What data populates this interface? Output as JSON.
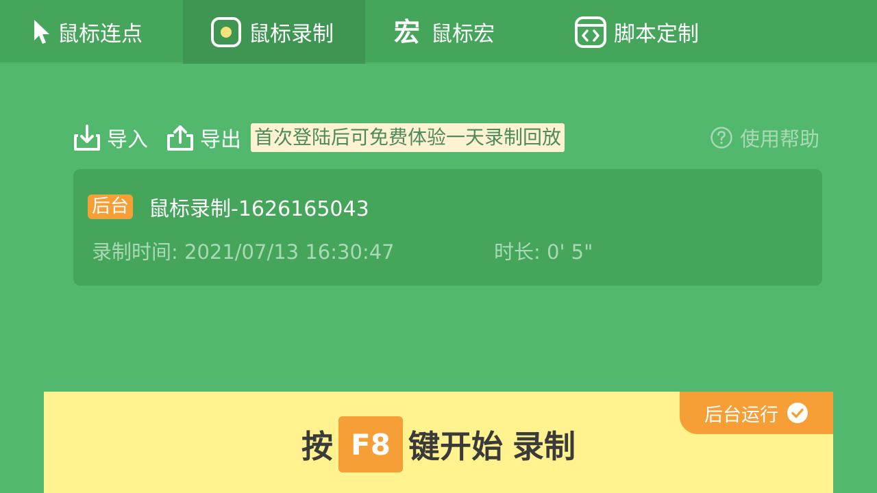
{
  "nav": {
    "tabs": [
      {
        "label": "鼠标连点",
        "icon": "cursor-arrow-icon"
      },
      {
        "label": "鼠标录制",
        "icon": "record-dot-icon",
        "active": true
      },
      {
        "label": "鼠标宏",
        "icon": "macro-glyph-icon",
        "glyph": "宏"
      },
      {
        "label": "脚本定制",
        "icon": "code-window-icon"
      }
    ]
  },
  "toolbar": {
    "import_label": "导入",
    "export_label": "导出",
    "promo_text": "首次登陆后可免费体验一天录制回放",
    "help_label": "使用帮助"
  },
  "recording": {
    "tag": "后台",
    "name": "鼠标录制-1626165043",
    "time_label": "录制时间: 2021/07/13 16:30:47",
    "duration_label": "时长:  0' 5\""
  },
  "start_panel": {
    "background_run_label": "后台运行",
    "hint_prefix": "按",
    "key": "F8",
    "hint_middle": "键开始",
    "hint_suffix": "录制"
  },
  "colors": {
    "background": "#52b86d",
    "nav_background": "#45a65b",
    "active_tab": "#3e9652",
    "accent_orange": "#f59f36",
    "panel_yellow": "#fff28f",
    "promo_background": "#fdf2d2",
    "muted_text": "#a9dab5"
  }
}
